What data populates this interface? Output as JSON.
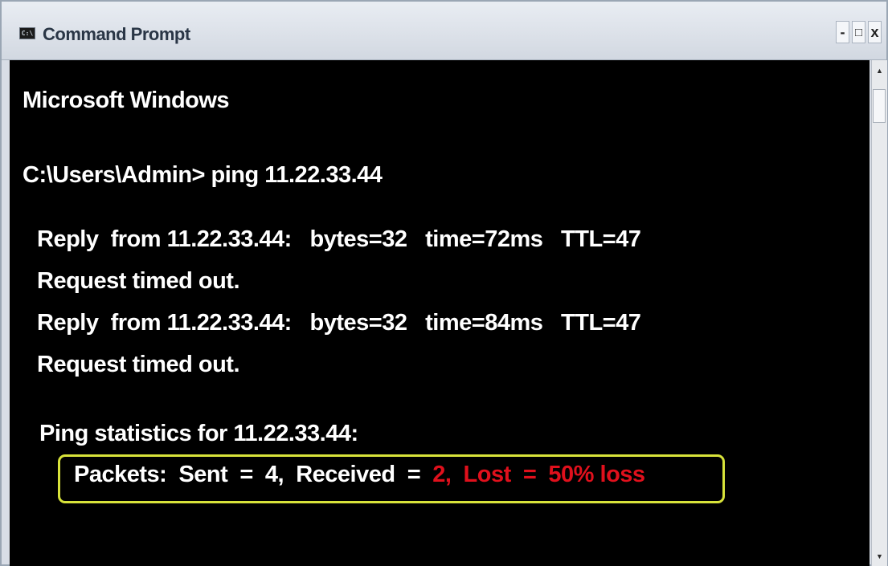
{
  "window": {
    "title": "Command Prompt",
    "icon": "cmd-console-icon",
    "icon_text": "C:\\",
    "controls": {
      "minimize": "-",
      "maximize": "□",
      "close": "x"
    }
  },
  "console": {
    "banner": "Microsoft Windows",
    "command_line": "C:\\Users\\Admin> ping 11.22.33.44",
    "replies": [
      "Reply  from 11.22.33.44:   bytes=32   time=72ms   TTL=47",
      "Request timed out.",
      "Reply  from 11.22.33.44:   bytes=32   time=84ms   TTL=47",
      "Request timed out."
    ],
    "stats_header": "Ping statistics for 11.22.33.44:",
    "packets": {
      "label": "Packets:  Sent  =  4,  Received  =  ",
      "highlight_text": "2,  Lost  =  50% loss"
    }
  },
  "scrollbar": {
    "up_arrow": "▲",
    "down_arrow": "▼"
  },
  "colors": {
    "console_bg": "#000000",
    "console_text": "#ffffff",
    "highlight_border": "#d8e33a",
    "loss_text": "#e0101c"
  }
}
